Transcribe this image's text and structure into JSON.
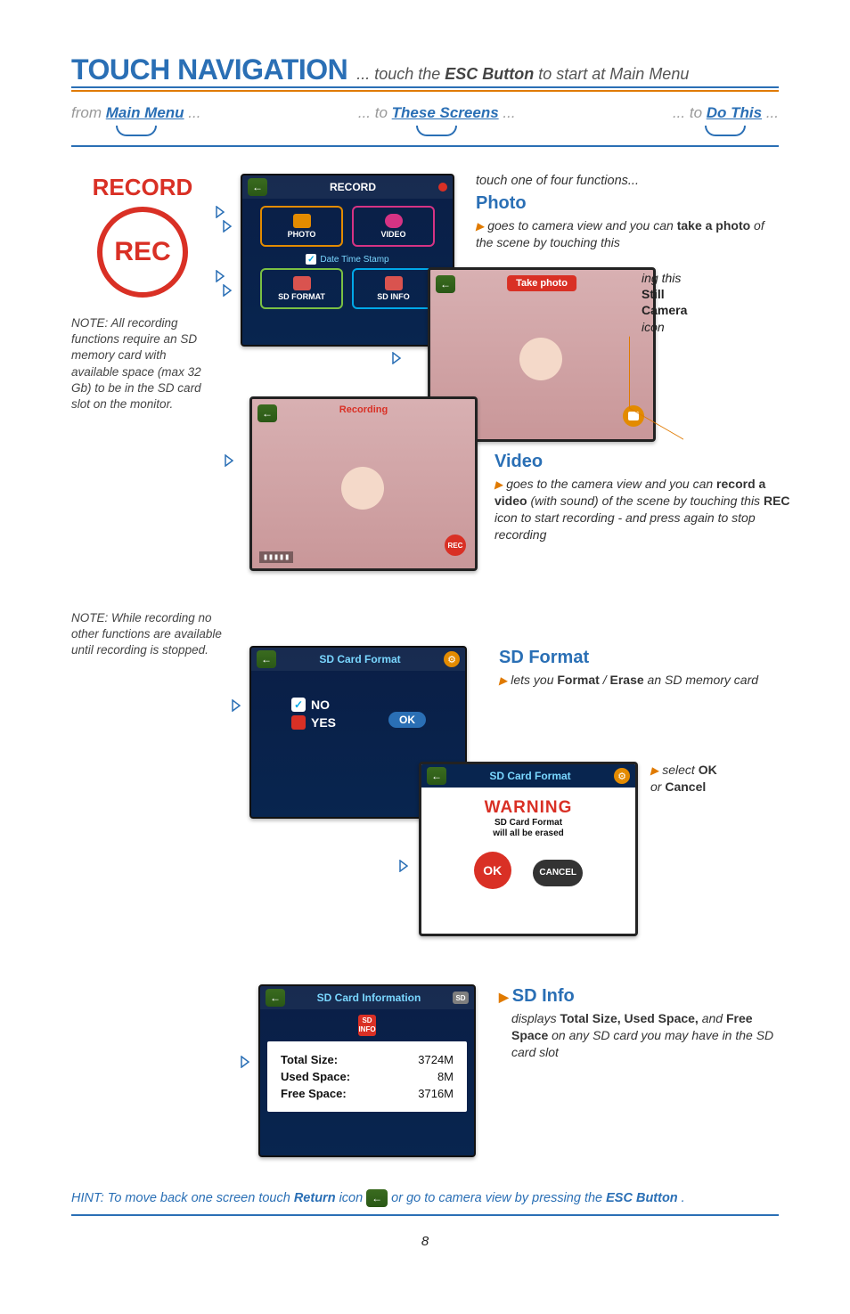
{
  "title": {
    "main": "TOUCH NAVIGATION",
    "sub_prefix": "... touch the ",
    "sub_bold": "ESC Button",
    "sub_suffix": " to start at Main Menu"
  },
  "nav": {
    "left": {
      "prefix": "from ",
      "link": "Main Menu",
      "suffix": " ..."
    },
    "mid": {
      "prefix": "... to ",
      "link": "These Screens",
      "suffix": " ..."
    },
    "right": {
      "prefix": "... to ",
      "link": "Do This",
      "suffix": " ..."
    }
  },
  "record": {
    "title": "RECORD",
    "icon_text": "REC",
    "note1": "NOTE: All recording functions require an SD memory card with available space (max 32 Gb) to be in the SD card slot on the monitor.",
    "note2": "NOTE: While recording no other functions are available until recording is stopped."
  },
  "screen_record": {
    "title": "RECORD",
    "cells": {
      "photo": "PHOTO",
      "video": "VIDEO",
      "format": "FORMAT",
      "info": "INFO",
      "sd": "SD"
    },
    "date_stamp": "Date Time Stamp"
  },
  "screen_photo": {
    "button": "Take photo",
    "signal": "▮▮▮▮▮"
  },
  "screen_video": {
    "label": "Recording",
    "rec_badge": "REC",
    "signal": "▮▮▮▮▮"
  },
  "screen_sdformat": {
    "title": "SD Card Format",
    "no": "NO",
    "yes": "YES",
    "ok": "OK"
  },
  "screen_sdwarn": {
    "title": "SD Card Format",
    "warn": "WARNING",
    "sub_l1": "SD Card Format",
    "sub_l2": "will all be erased",
    "ok": "OK",
    "cancel": "CANCEL"
  },
  "screen_sdinfo": {
    "title": "SD Card Information",
    "chip": "SD",
    "chip_sub": "INFO",
    "rows": [
      {
        "label": "Total  Size:",
        "value": "3724M"
      },
      {
        "label": "Used Space:",
        "value": "8M"
      },
      {
        "label": "Free  Space:",
        "value": "3716M"
      }
    ],
    "sd_pill": "SD"
  },
  "right": {
    "intro": "touch one of four functions...",
    "photo": {
      "title": "Photo",
      "text_prefix": "goes to camera view and you can ",
      "text_bold": "take a photo",
      "text_suffix": " of the scene by touching this ",
      "still_l1": "ing this",
      "still_b1": "Still",
      "still_b2": "Camera",
      "still_l2": "icon"
    },
    "video": {
      "title": "Video",
      "text": "goes to the camera view and you can ",
      "bold1": "record a video",
      "mid": " (with sound) of the scene by touching this ",
      "bold2": "REC",
      "suffix": " icon to start recording - and press again to stop recording"
    },
    "sdformat": {
      "title": "SD Format",
      "text_prefix": "lets you ",
      "bold1": "Format",
      "mid": " / ",
      "bold2": "Erase",
      "suffix": " an SD memory card"
    },
    "sdwarn": {
      "text_prefix": "select ",
      "bold1": "OK",
      "mid": " or ",
      "bold2": "Cancel"
    },
    "sdinfo": {
      "title": "SD Info",
      "text_prefix": "displays ",
      "bold1": "Total Size, Used Space,",
      "mid": " and ",
      "bold2": "Free Space",
      "suffix": " on any SD card you may have in the SD card slot"
    }
  },
  "hint": {
    "prefix": "HINT: To move back one screen touch ",
    "bold1": "Return",
    "mid": " icon ",
    "suffix": " or go to camera view by pressing the ",
    "bold2": "ESC Button",
    "dot": "."
  },
  "page_number": "8"
}
